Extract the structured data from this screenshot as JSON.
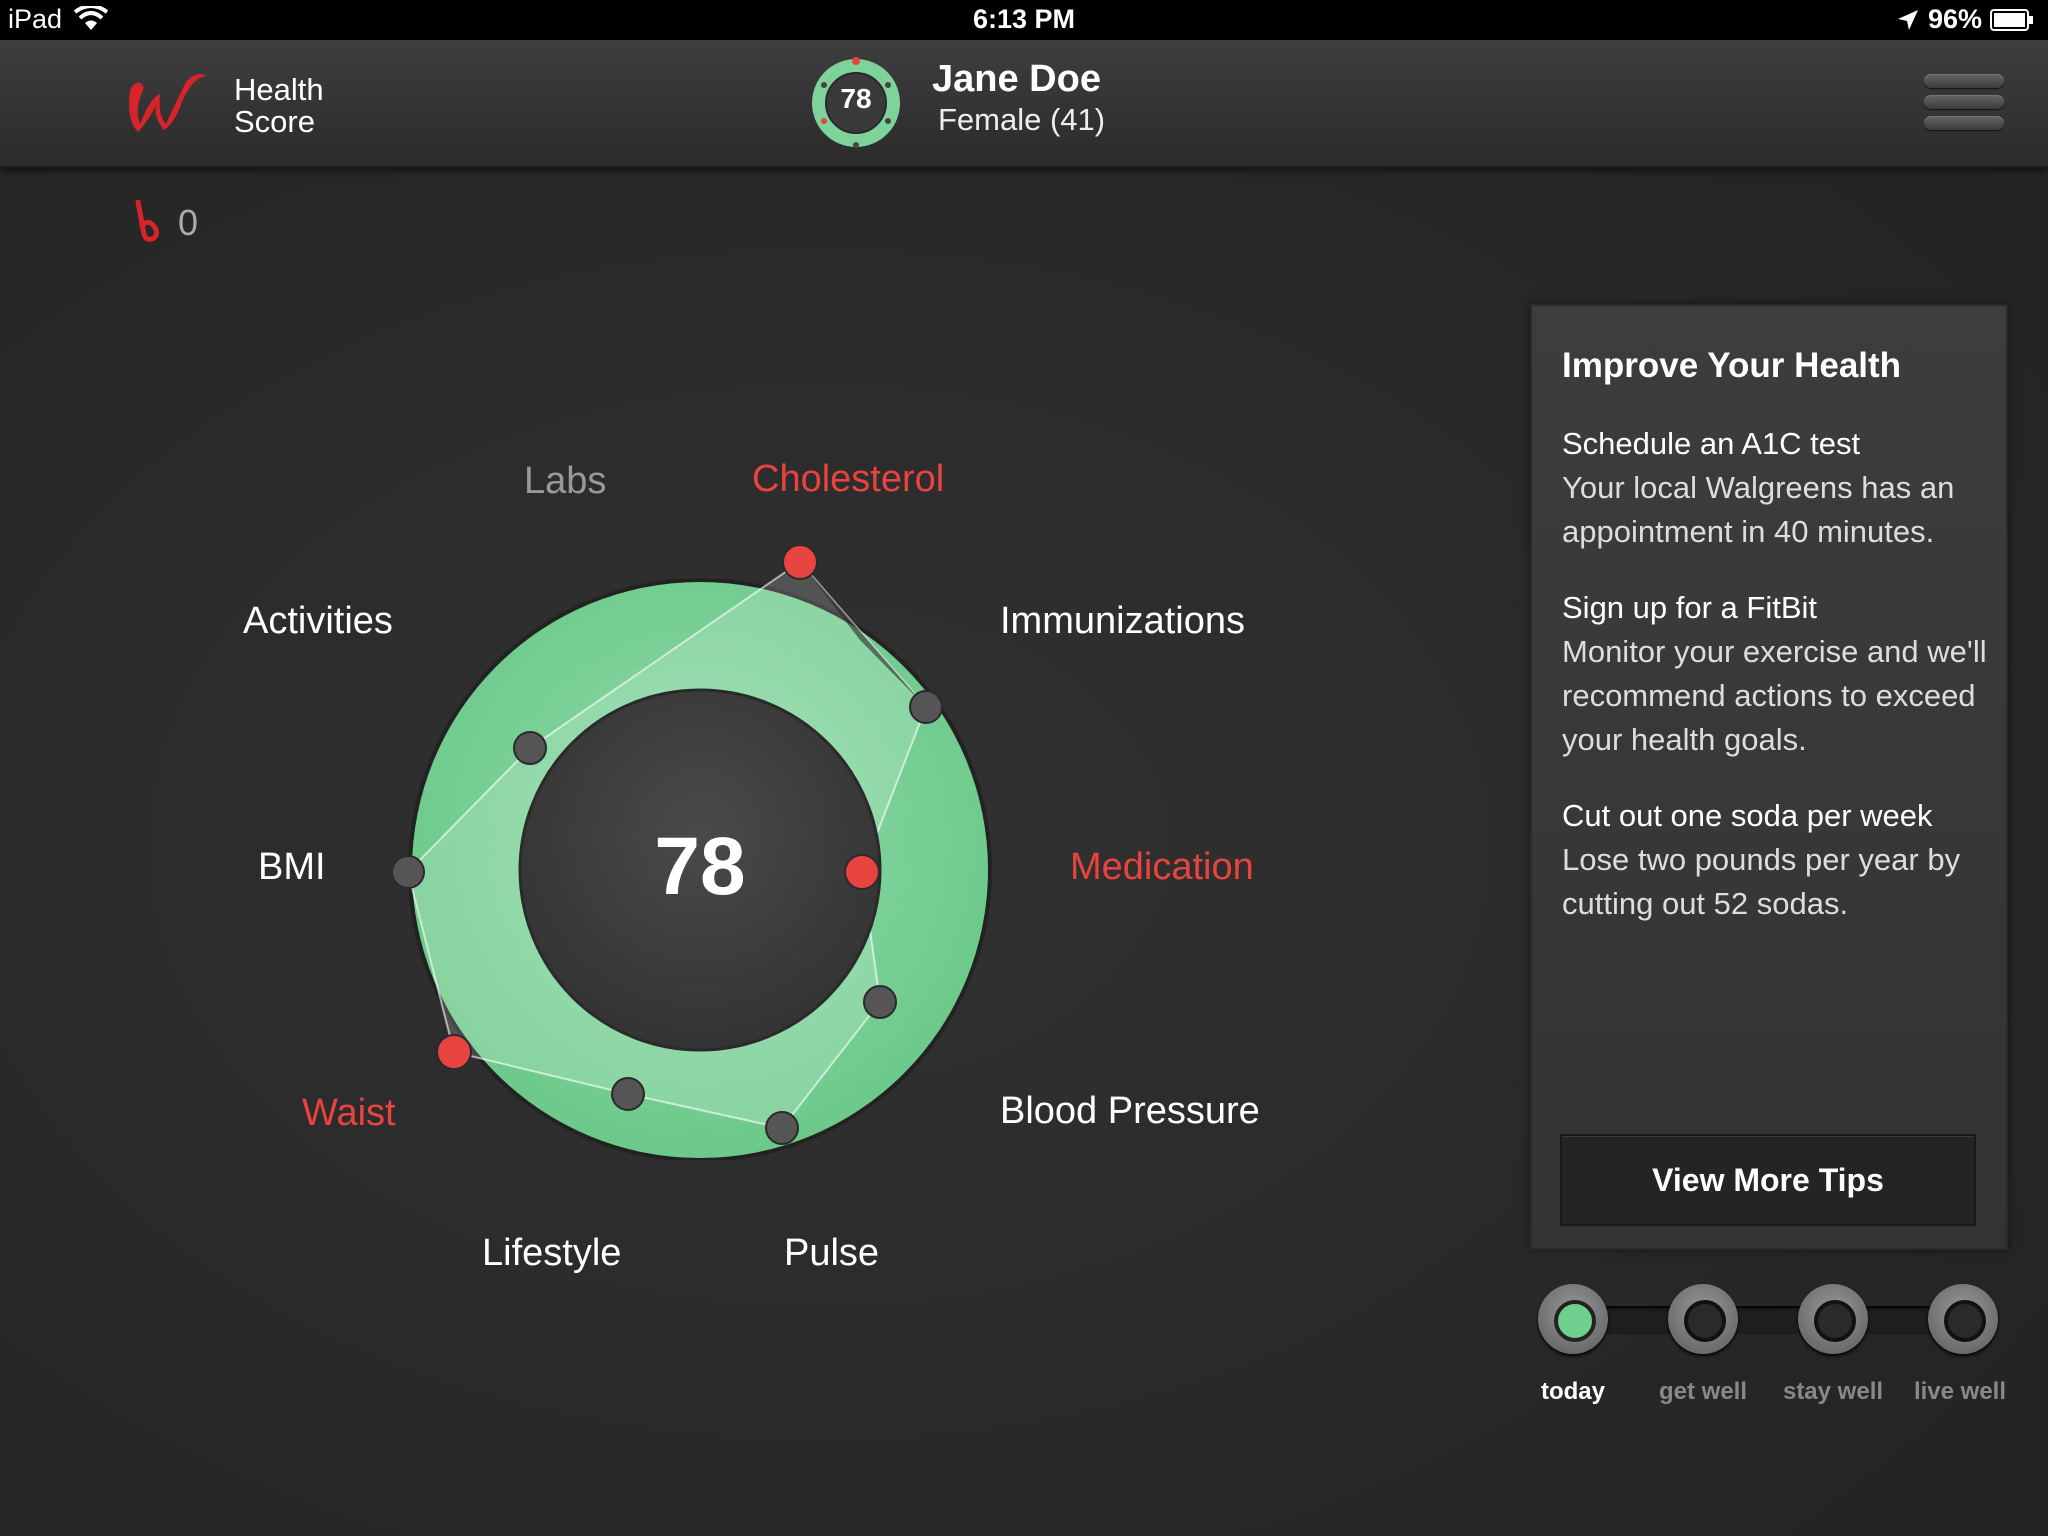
{
  "status_bar": {
    "carrier": "iPad",
    "time": "6:13 PM",
    "battery": "96%"
  },
  "header": {
    "app_name_line1": "Health",
    "app_name_line2": "Score",
    "avatar_score": "78",
    "user_name": "Jane Doe",
    "user_detail": "Female (41)"
  },
  "points": {
    "value": "0"
  },
  "wheel": {
    "score": "78",
    "categories": [
      {
        "label": "Labs",
        "state": "inactive"
      },
      {
        "label": "Cholesterol",
        "state": "alert"
      },
      {
        "label": "Immunizations",
        "state": "normal"
      },
      {
        "label": "Medication",
        "state": "alert"
      },
      {
        "label": "Blood Pressure",
        "state": "normal"
      },
      {
        "label": "Pulse",
        "state": "normal"
      },
      {
        "label": "Lifestyle",
        "state": "normal"
      },
      {
        "label": "Waist",
        "state": "alert"
      },
      {
        "label": "BMI",
        "state": "normal"
      },
      {
        "label": "Activities",
        "state": "normal"
      }
    ],
    "colors": {
      "ring": "#7ed39a",
      "alert": "#e8443f",
      "normal_dot": "#555555"
    }
  },
  "tips": {
    "title": "Improve Your Health",
    "items": [
      {
        "title": "Schedule an A1C test",
        "body": "Your local Walgreens has an appointment in 40 minutes."
      },
      {
        "title": "Sign up for a FitBit",
        "body": "Monitor your exercise and we'll recommend actions to exceed your health goals."
      },
      {
        "title": "Cut out one soda per week",
        "body": "Lose two pounds per year by cutting out 52 sodas."
      }
    ],
    "button_label": "View More Tips"
  },
  "timeline": {
    "steps": [
      {
        "label": "today",
        "active": true
      },
      {
        "label": "get well",
        "active": false
      },
      {
        "label": "stay well",
        "active": false
      },
      {
        "label": "live well",
        "active": false
      }
    ]
  }
}
